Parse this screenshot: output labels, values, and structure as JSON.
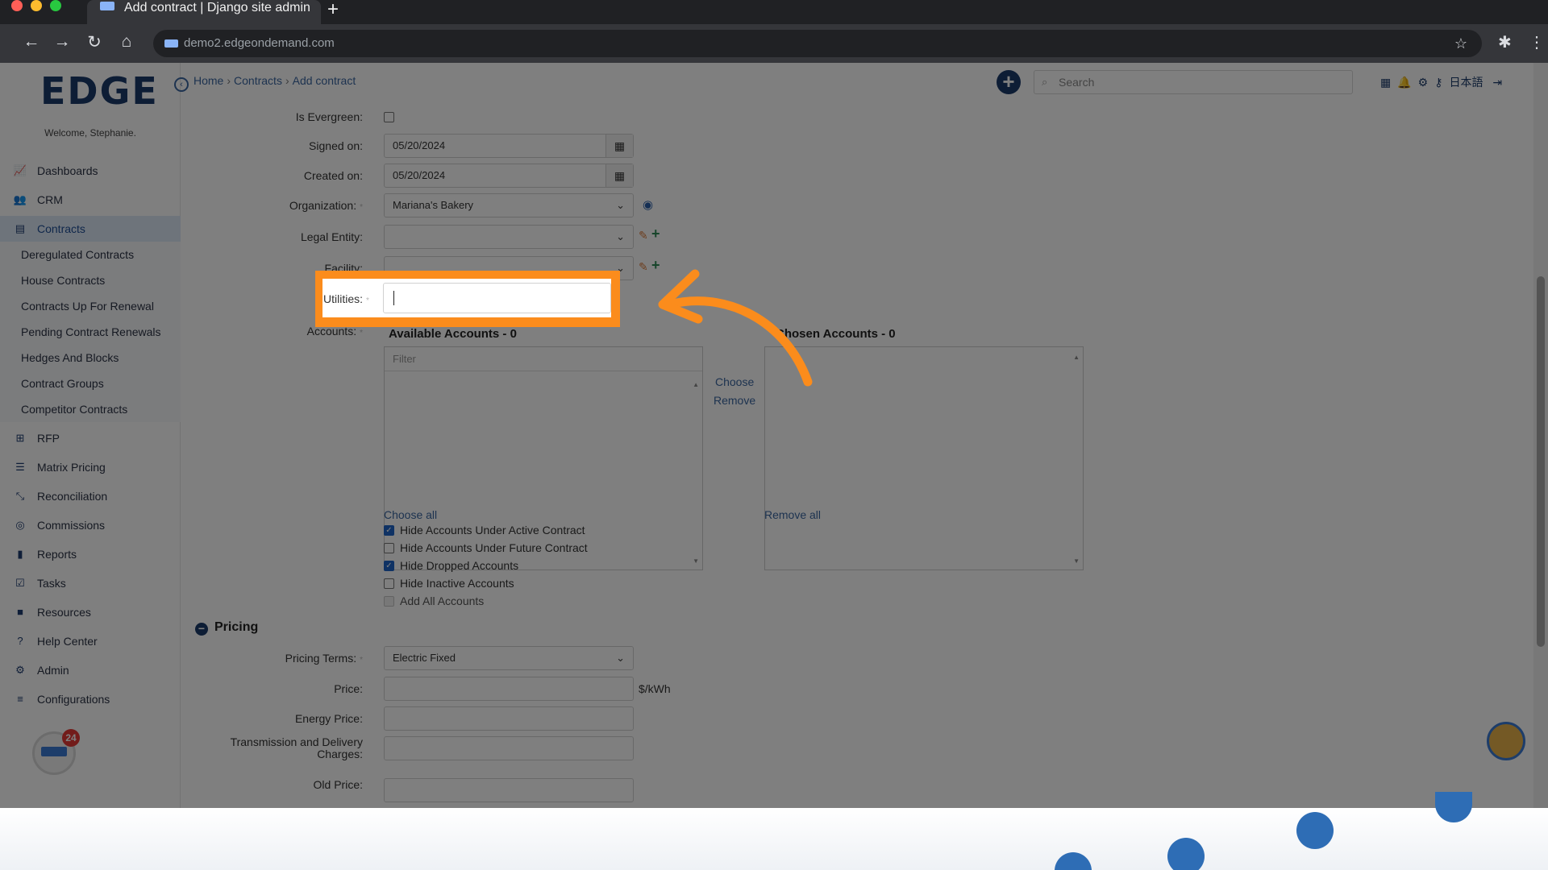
{
  "browser": {
    "tab_title": "Add contract | Django site admin",
    "url": "demo2.edgeondemand.com"
  },
  "sidebar": {
    "logo": "EDGE",
    "welcome": "Welcome, Stephanie.",
    "items": [
      {
        "label": "Dashboards",
        "icon": "chart-line-icon"
      },
      {
        "label": "CRM",
        "icon": "users-icon"
      },
      {
        "label": "Contracts",
        "icon": "file-icon"
      },
      {
        "label": "RFP",
        "icon": "sitemap-icon"
      },
      {
        "label": "Matrix Pricing",
        "icon": "list-icon"
      },
      {
        "label": "Reconciliation",
        "icon": "compress-icon"
      },
      {
        "label": "Commissions",
        "icon": "coins-icon"
      },
      {
        "label": "Reports",
        "icon": "bar-chart-icon"
      },
      {
        "label": "Tasks",
        "icon": "calendar-check-icon"
      },
      {
        "label": "Resources",
        "icon": "folder-icon"
      },
      {
        "label": "Help Center",
        "icon": "question-icon"
      },
      {
        "label": "Admin",
        "icon": "cogs-icon"
      },
      {
        "label": "Configurations",
        "icon": "sliders-icon"
      }
    ],
    "contracts_sub": [
      "Deregulated Contracts",
      "House Contracts",
      "Contracts Up For Renewal",
      "Pending Contract Renewals",
      "Hedges And Blocks",
      "Contract Groups",
      "Competitor Contracts"
    ],
    "badge_count": "24"
  },
  "breadcrumb": {
    "home": "Home",
    "contracts": "Contracts",
    "current": "Add contract"
  },
  "header": {
    "search_placeholder": "Search",
    "language": "日本語"
  },
  "form": {
    "is_evergreen_label": "Is Evergreen:",
    "signed_on_label": "Signed on:",
    "signed_on_value": "05/20/2024",
    "created_on_label": "Created on:",
    "created_on_value": "05/20/2024",
    "organization_label": "Organization:",
    "organization_value": "Mariana's Bakery",
    "legal_entity_label": "Legal Entity:",
    "facility_label": "Facility:",
    "utilities_label": "Utilities:",
    "accounts_label": "Accounts:",
    "available_title": "Available Accounts - 0",
    "chosen_title": "Chosen Accounts - 0",
    "filter_placeholder": "Filter",
    "choose": "Choose",
    "remove": "Remove",
    "choose_all": "Choose all",
    "remove_all": "Remove all",
    "checkboxes": [
      {
        "label": "Hide Accounts Under Active Contract",
        "checked": true
      },
      {
        "label": "Hide Accounts Under Future Contract",
        "checked": false
      },
      {
        "label": "Hide Dropped Accounts",
        "checked": true
      },
      {
        "label": "Hide Inactive Accounts",
        "checked": false
      },
      {
        "label": "Add All Accounts",
        "checked": false,
        "disabled": true
      }
    ]
  },
  "pricing": {
    "section_title": "Pricing",
    "pricing_terms_label": "Pricing Terms:",
    "pricing_terms_value": "Electric Fixed",
    "price_label": "Price:",
    "price_unit": "$/kWh",
    "energy_price_label": "Energy Price:",
    "tnd_label": "Transmission and Delivery Charges:",
    "old_price_label": "Old Price:"
  },
  "colors": {
    "highlight": "#fb8c1c",
    "brand": "#1b3a6b",
    "link": "#3b66a0"
  }
}
